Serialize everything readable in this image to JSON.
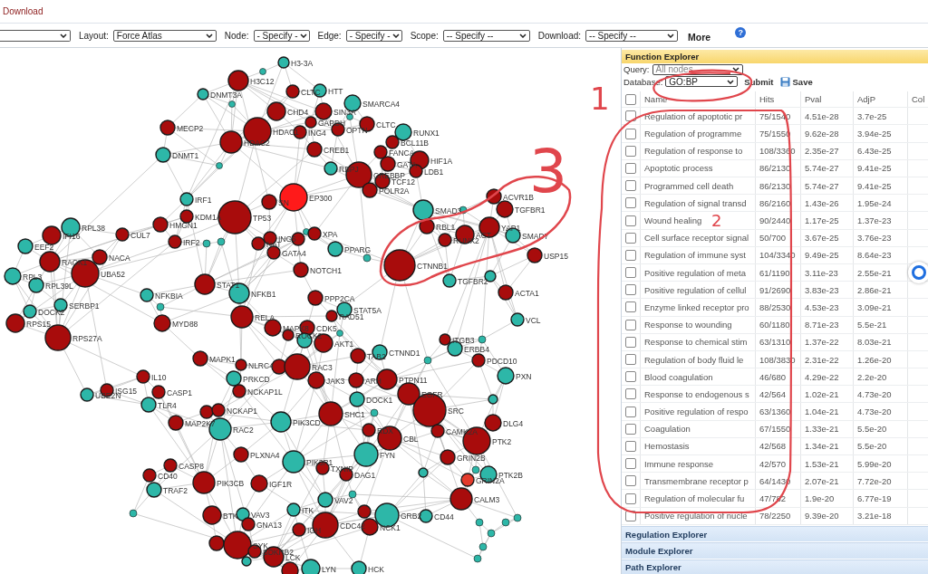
{
  "title_bar": {
    "link": "Download"
  },
  "toolbar": [
    {
      "kind": "dropdown"
    },
    {
      "kind": "dropdown",
      "label": "Layout:",
      "value": "Force Atlas"
    },
    {
      "kind": "dropdown",
      "label": "Node:",
      "value": "- Specify -"
    },
    {
      "kind": "dropdown",
      "label": "Edge:",
      "value": "- Specify -"
    },
    {
      "kind": "dropdown",
      "label": "Scope:",
      "value": "-- Specify --"
    },
    {
      "kind": "dropdown",
      "label": "Download:",
      "value": "-- Specify --"
    },
    {
      "kind": "link",
      "label": "More"
    },
    {
      "kind": "help",
      "label": "?"
    }
  ],
  "graph": {
    "nodes": [
      {
        "label": "H3-3A",
        "color": "#2db7a8"
      },
      {
        "color": "#2db7a8"
      },
      {
        "label": "H3C12",
        "color": "#a80c0c"
      },
      {
        "label": "DNMT3A",
        "color": "#2db7a8"
      },
      {
        "label": "CLTC",
        "color": "#a80c0c"
      },
      {
        "label": "HTT",
        "color": "#2db7a8"
      },
      {
        "color": "#2db7a8"
      },
      {
        "label": "SMARCA4",
        "color": "#2db7a8"
      },
      {
        "label": "CHD4",
        "color": "#a80c0c"
      },
      {
        "label": "SIN3A",
        "color": "#a80c0c"
      },
      {
        "label": "GAPDH",
        "color": "#a80c0c"
      },
      {
        "color": "#2db7a8"
      },
      {
        "label": "CLTC",
        "color": "#a80c0c"
      },
      {
        "label": "MECP2",
        "color": "#a80c0c"
      },
      {
        "label": "HDAC1",
        "color": "#a80c0c"
      },
      {
        "label": "ING4",
        "color": "#a80c0c"
      },
      {
        "label": "OPTN",
        "color": "#a80c0c"
      },
      {
        "label": "RUNX1",
        "color": "#2db7a8"
      },
      {
        "label": "HDAC2",
        "color": "#a80c0c"
      },
      {
        "label": "BCL11B",
        "color": "#a80c0c"
      },
      {
        "label": "DNMT1",
        "color": "#2db7a8"
      },
      {
        "label": "CREB1",
        "color": "#a80c0c"
      },
      {
        "label": "FANCA",
        "color": "#a80c0c"
      },
      {
        "color": "#2db7a8"
      },
      {
        "label": "GATA",
        "color": "#a80c0c"
      },
      {
        "label": "HIF1A",
        "color": "#a80c0c"
      },
      {
        "label": "RBPJ",
        "color": "#2db7a8"
      },
      {
        "label": "CREBBP",
        "color": "#a80c0c"
      },
      {
        "label": "LDB1",
        "color": "#a80c0c"
      },
      {
        "label": "TCF12",
        "color": "#a80c0c"
      },
      {
        "label": "POLR2A",
        "color": "#a80c0c"
      },
      {
        "label": "IRF1",
        "color": "#2db7a8"
      },
      {
        "label": "SN",
        "color": "#a80c0c"
      },
      {
        "label": "EP300",
        "color": "#ff1a1a"
      },
      {
        "label": "ACVR1B",
        "color": "#a80c0c"
      },
      {
        "label": "SMAD3",
        "color": "#2db7a8"
      },
      {
        "color": "#2db7a8"
      },
      {
        "label": "TGFBR1",
        "color": "#a80c0c"
      },
      {
        "label": "KDM1A",
        "color": "#a80c0c"
      },
      {
        "label": "TP53",
        "color": "#a80c0c"
      },
      {
        "label": "RPL38",
        "color": "#2db7a8"
      },
      {
        "label": "HMGN1",
        "color": "#a80c0c"
      },
      {
        "label": "RBL1",
        "color": "#a80c0c"
      },
      {
        "label": "YAP1",
        "color": "#a80c0c"
      },
      {
        "label": "IFI16",
        "color": "#a80c0c"
      },
      {
        "label": "CUL7",
        "color": "#a80c0c"
      },
      {
        "color": "#2db7a8"
      },
      {
        "label": "XPA",
        "color": "#a80c0c"
      },
      {
        "label": "ACT",
        "color": "#a80c0c"
      },
      {
        "label": "SMAD7",
        "color": "#2db7a8"
      },
      {
        "label": "IRF2",
        "color": "#a80c0c"
      },
      {
        "color": "#2db7a8"
      },
      {
        "color": "#2db7a8"
      },
      {
        "label": "NAT",
        "color": "#a80c0c"
      },
      {
        "label": "ING5",
        "color": "#a80c0c"
      },
      {
        "color": "#a80c0c"
      },
      {
        "label": "RUNX2",
        "color": "#a80c0c"
      },
      {
        "label": "EEF2",
        "color": "#2db7a8"
      },
      {
        "label": "GATA4",
        "color": "#a80c0c"
      },
      {
        "label": "PPARG",
        "color": "#2db7a8"
      },
      {
        "label": "NACA",
        "color": "#a80c0c"
      },
      {
        "color": "#2db7a8"
      },
      {
        "label": "USP15",
        "color": "#a80c0c"
      },
      {
        "label": "RACK1",
        "color": "#a80c0c"
      },
      {
        "label": "NOTCH1",
        "color": "#a80c0c"
      },
      {
        "label": "CTNNB1",
        "color": "#a80c0c"
      },
      {
        "label": "RPL3",
        "color": "#2db7a8"
      },
      {
        "label": "UBA52",
        "color": "#a80c0c"
      },
      {
        "color": "#2db7a8"
      },
      {
        "label": "RPL39L",
        "color": "#2db7a8"
      },
      {
        "label": "STAT1",
        "color": "#a80c0c"
      },
      {
        "label": "TGFBR2",
        "color": "#2db7a8"
      },
      {
        "label": "NFKBIA",
        "color": "#2db7a8"
      },
      {
        "label": "NFKB1",
        "color": "#2db7a8"
      },
      {
        "label": "ACTA1",
        "color": "#a80c0c"
      },
      {
        "label": "PPP2CA",
        "color": "#a80c0c"
      },
      {
        "label": "DOCK2",
        "color": "#2db7a8"
      },
      {
        "label": "SERBP1",
        "color": "#2db7a8"
      },
      {
        "color": "#2db7a8"
      },
      {
        "label": "STAT5A",
        "color": "#2db7a8"
      },
      {
        "label": "RPS15",
        "color": "#a80c0c"
      },
      {
        "label": "MYD88",
        "color": "#a80c0c"
      },
      {
        "label": "RELA",
        "color": "#a80c0c"
      },
      {
        "label": "MAPK8",
        "color": "#a80c0c"
      },
      {
        "label": "CDK5",
        "color": "#a80c0c"
      },
      {
        "label": "RAD51",
        "color": "#a80c0c"
      },
      {
        "label": "VCL",
        "color": "#2db7a8"
      },
      {
        "label": "RPS27A",
        "color": "#a80c0c"
      },
      {
        "label": "ROCK2",
        "color": "#a80c0c"
      },
      {
        "color": "#2db7a8"
      },
      {
        "label": "AKT1",
        "color": "#a80c0c"
      },
      {
        "color": "#2db7a8"
      },
      {
        "label": "ITGB3",
        "color": "#a80c0c"
      },
      {
        "color": "#2db7a8"
      },
      {
        "label": "MAPK1",
        "color": "#a80c0c"
      },
      {
        "label": "TAB2",
        "color": "#a80c0c"
      },
      {
        "label": "CTNND1",
        "color": "#2db7a8"
      },
      {
        "color": "#2db7a8"
      },
      {
        "label": "ERBB4",
        "color": "#2db7a8"
      },
      {
        "label": "PDCD10",
        "color": "#a80c0c"
      },
      {
        "label": "NLRC4",
        "color": "#a80c0c"
      },
      {
        "color": "#a80c0c"
      },
      {
        "label": "RAC3",
        "color": "#a80c0c"
      },
      {
        "label": "IL10",
        "color": "#a80c0c"
      },
      {
        "label": "PRKCD",
        "color": "#2db7a8"
      },
      {
        "label": "JAK3",
        "color": "#a80c0c"
      },
      {
        "label": "ARH",
        "color": "#a80c0c"
      },
      {
        "label": "PTPN11",
        "color": "#a80c0c"
      },
      {
        "label": "PXN",
        "color": "#2db7a8"
      },
      {
        "label": "UBE2N",
        "color": "#2db7a8"
      },
      {
        "label": "ISG15",
        "color": "#a80c0c"
      },
      {
        "label": "CASP1",
        "color": "#a80c0c"
      },
      {
        "label": "NCKAP1L",
        "color": "#a80c0c"
      },
      {
        "label": "DOCK1",
        "color": "#2db7a8"
      },
      {
        "label": "EGFR",
        "color": "#a80c0c"
      },
      {
        "color": "#2db7a8"
      },
      {
        "label": "TLR4",
        "color": "#2db7a8"
      },
      {
        "color": "#a80c0c"
      },
      {
        "label": "NCKAP1",
        "color": "#a80c0c"
      },
      {
        "label": "SHC1",
        "color": "#a80c0c"
      },
      {
        "color": "#2db7a8"
      },
      {
        "label": "SRC",
        "color": "#a80c0c"
      },
      {
        "label": "MAP2K7",
        "color": "#a80c0c"
      },
      {
        "label": "PIK3CD",
        "color": "#2db7a8"
      },
      {
        "label": "DLG4",
        "color": "#a80c0c"
      },
      {
        "label": "RAC2",
        "color": "#2db7a8"
      },
      {
        "label": "RDX",
        "color": "#a80c0c"
      },
      {
        "label": "CAMK2A",
        "color": "#a80c0c"
      },
      {
        "label": "CBL",
        "color": "#a80c0c"
      },
      {
        "label": "PTK2",
        "color": "#a80c0c"
      },
      {
        "label": "PLXNA4",
        "color": "#a80c0c"
      },
      {
        "label": "FYN",
        "color": "#2db7a8"
      },
      {
        "label": "GRIN2B",
        "color": "#a80c0c"
      },
      {
        "label": "CASP8",
        "color": "#a80c0c"
      },
      {
        "label": "PIK3R1",
        "color": "#2db7a8"
      },
      {
        "label": "CD40",
        "color": "#a80c0c"
      },
      {
        "label": "TXNIP",
        "color": "#a80c0c"
      },
      {
        "label": "DAG1",
        "color": "#a80c0c"
      },
      {
        "color": "#2db7a8"
      },
      {
        "color": "#2db7a8"
      },
      {
        "label": "PTK2B",
        "color": "#2db7a8"
      },
      {
        "label": "PIK3CB",
        "color": "#a80c0c"
      },
      {
        "label": "IGF1R",
        "color": "#a80c0c"
      },
      {
        "label": "GRIN2A",
        "color": "#e33b2c"
      },
      {
        "label": "TRAF2",
        "color": "#2db7a8"
      },
      {
        "color": "#2db7a8"
      },
      {
        "label": "VAV2",
        "color": "#2db7a8"
      },
      {
        "label": "CALM3",
        "color": "#a80c0c"
      },
      {
        "color": "#2db7a8"
      },
      {
        "label": "BTK",
        "color": "#a80c0c"
      },
      {
        "label": "VAV3",
        "color": "#2db7a8"
      },
      {
        "label": "ITK",
        "color": "#2db7a8"
      },
      {
        "color": "#a80c0c"
      },
      {
        "label": "GRB2",
        "color": "#2db7a8"
      },
      {
        "label": "CD44",
        "color": "#2db7a8"
      },
      {
        "color": "#2db7a8"
      },
      {
        "label": "GNA13",
        "color": "#a80c0c"
      },
      {
        "label": "IGH",
        "color": "#a80c0c"
      },
      {
        "label": "CDC42",
        "color": "#a80c0c"
      },
      {
        "label": "NCK1",
        "color": "#a80c0c"
      },
      {
        "color": "#2db7a8"
      },
      {
        "color": "#2db7a8"
      },
      {
        "color": "#2db7a8"
      },
      {
        "color": "#a80c0c"
      },
      {
        "label": "SYK",
        "color": "#a80c0c"
      },
      {
        "color": "#2db7a8"
      },
      {
        "label": "BDKRB2",
        "color": "#a80c0c"
      },
      {
        "color": "#2db7a8"
      },
      {
        "label": "LCK",
        "color": "#a80c0c"
      },
      {
        "color": "#2db7a8"
      },
      {
        "color": "#a80c0c"
      },
      {
        "label": "LYN",
        "color": "#2db7a8"
      },
      {
        "label": "HCK",
        "color": "#2db7a8"
      }
    ]
  },
  "function_explorer": {
    "title": "Function Explorer",
    "query": {
      "label": "Query:",
      "value": "All nodes"
    },
    "database": {
      "label": "Database:",
      "value": "GO:BP"
    },
    "submit": "Submit",
    "save": "Save",
    "table": {
      "select_all_checked": false,
      "columns": [
        "Name",
        "Hits",
        "Pval",
        "AdjP",
        "Col"
      ],
      "rows": [
        {
          "checked": false,
          "cells": [
            "Regulation of apoptotic pr",
            "75/1540",
            "4.51e-28",
            "3.7e-25"
          ]
        },
        {
          "checked": false,
          "cells": [
            "Regulation of programme",
            "75/1550",
            "9.62e-28",
            "3.94e-25"
          ]
        },
        {
          "checked": false,
          "cells": [
            "Regulation of response to",
            "108/3360",
            "2.35e-27",
            "6.43e-25"
          ]
        },
        {
          "checked": false,
          "cells": [
            "Apoptotic process",
            "86/2130",
            "5.74e-27",
            "9.41e-25"
          ]
        },
        {
          "checked": false,
          "cells": [
            "Programmed cell death",
            "86/2130",
            "5.74e-27",
            "9.41e-25"
          ]
        },
        {
          "checked": false,
          "cells": [
            "Regulation of signal transd",
            "86/2160",
            "1.43e-26",
            "1.95e-24"
          ]
        },
        {
          "checked": false,
          "cells": [
            "Wound healing",
            "90/2440",
            "1.17e-25",
            "1.37e-23"
          ]
        },
        {
          "checked": false,
          "cells": [
            "Cell surface receptor signal",
            "50/700",
            "3.67e-25",
            "3.76e-23"
          ]
        },
        {
          "checked": false,
          "cells": [
            "Regulation of immune syst",
            "104/3340",
            "9.49e-25",
            "8.64e-23"
          ]
        },
        {
          "checked": false,
          "cells": [
            "Positive regulation of meta",
            "61/1190",
            "3.11e-23",
            "2.55e-21"
          ]
        },
        {
          "checked": false,
          "cells": [
            "Positive regulation of cellul",
            "91/2690",
            "3.83e-23",
            "2.86e-21"
          ]
        },
        {
          "checked": false,
          "cells": [
            "Enzyme linked receptor pro",
            "88/2530",
            "4.53e-23",
            "3.09e-21"
          ]
        },
        {
          "checked": false,
          "cells": [
            "Response to wounding",
            "60/1180",
            "8.71e-23",
            "5.5e-21"
          ]
        },
        {
          "checked": false,
          "cells": [
            "Response to chemical stim",
            "63/1310",
            "1.37e-22",
            "8.03e-21"
          ]
        },
        {
          "checked": false,
          "cells": [
            "Regulation of body fluid le",
            "108/3830",
            "2.31e-22",
            "1.26e-20"
          ]
        },
        {
          "checked": false,
          "cells": [
            "Blood coagulation",
            "46/680",
            "4.29e-22",
            "2.2e-20"
          ]
        },
        {
          "checked": false,
          "cells": [
            "Response to endogenous s",
            "42/564",
            "1.02e-21",
            "4.73e-20"
          ]
        },
        {
          "checked": false,
          "cells": [
            "Positive regulation of respo",
            "63/1360",
            "1.04e-21",
            "4.73e-20"
          ]
        },
        {
          "checked": false,
          "cells": [
            "Coagulation",
            "67/1550",
            "1.33e-21",
            "5.5e-20"
          ]
        },
        {
          "checked": false,
          "cells": [
            "Hemostasis",
            "42/568",
            "1.34e-21",
            "5.5e-20"
          ]
        },
        {
          "checked": false,
          "cells": [
            "Immune response",
            "42/570",
            "1.53e-21",
            "5.99e-20"
          ]
        },
        {
          "checked": false,
          "cells": [
            "Transmembrane receptor p",
            "64/1430",
            "2.07e-21",
            "7.72e-20"
          ]
        },
        {
          "checked": false,
          "cells": [
            "Regulation of molecular fu",
            "47/782",
            "1.9e-20",
            "6.77e-19"
          ]
        },
        {
          "checked": false,
          "cells": [
            "Positive regulation of nucle",
            "78/2250",
            "9.39e-20",
            "3.21e-18"
          ]
        }
      ]
    }
  },
  "explorers": [
    "Regulation Explorer",
    "Module Explorer",
    "Path Explorer"
  ],
  "annotations": [
    {
      "label": "1"
    },
    {
      "label": "3"
    },
    {
      "label": "2"
    }
  ]
}
